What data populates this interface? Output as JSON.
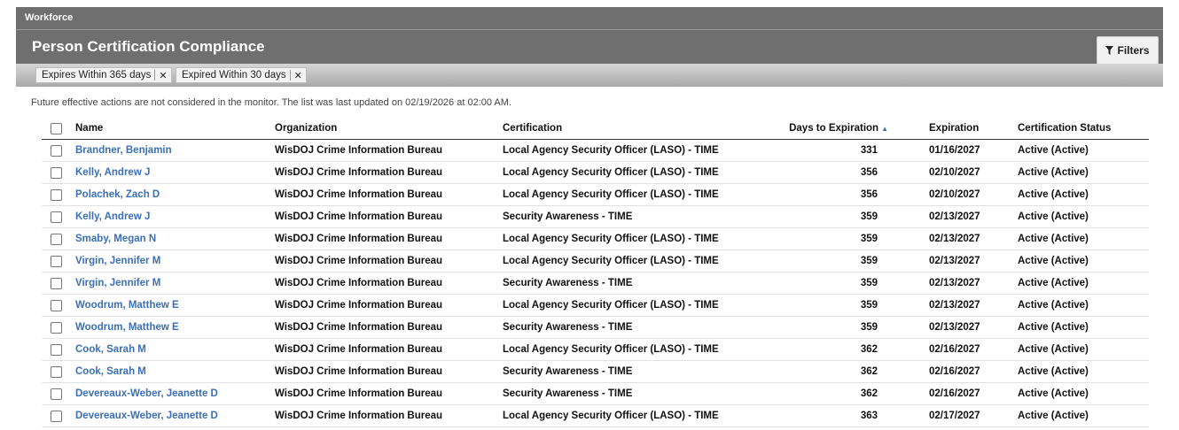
{
  "header": {
    "breadcrumb": "Workforce",
    "title": "Person Certification Compliance",
    "filters_label": "Filters"
  },
  "chips": [
    {
      "label": "Expires Within 365 days",
      "remove": "✕"
    },
    {
      "label": "Expired Within 30 days",
      "remove": "✕"
    }
  ],
  "notice": "Future effective actions are not considered in the monitor. The list was last updated on 02/19/2026 at 02:00 AM.",
  "table": {
    "columns": {
      "name": "Name",
      "org": "Organization",
      "cert": "Certification",
      "days": "Days to Expiration",
      "exp": "Expiration",
      "status": "Certification Status"
    },
    "rows": [
      {
        "name": "Brandner, Benjamin",
        "org": "WisDOJ Crime Information Bureau",
        "cert": "Local Agency Security Officer (LASO) - TIME",
        "days": "331",
        "exp": "01/16/2027",
        "status": "Active (Active)"
      },
      {
        "name": "Kelly, Andrew J",
        "org": "WisDOJ Crime Information Bureau",
        "cert": "Local Agency Security Officer (LASO) - TIME",
        "days": "356",
        "exp": "02/10/2027",
        "status": "Active (Active)"
      },
      {
        "name": "Polachek, Zach D",
        "org": "WisDOJ Crime Information Bureau",
        "cert": "Local Agency Security Officer (LASO) - TIME",
        "days": "356",
        "exp": "02/10/2027",
        "status": "Active (Active)"
      },
      {
        "name": "Kelly, Andrew J",
        "org": "WisDOJ Crime Information Bureau",
        "cert": "Security Awareness - TIME",
        "days": "359",
        "exp": "02/13/2027",
        "status": "Active (Active)"
      },
      {
        "name": "Smaby, Megan N",
        "org": "WisDOJ Crime Information Bureau",
        "cert": "Local Agency Security Officer (LASO) - TIME",
        "days": "359",
        "exp": "02/13/2027",
        "status": "Active (Active)"
      },
      {
        "name": "Virgin, Jennifer M",
        "org": "WisDOJ Crime Information Bureau",
        "cert": "Local Agency Security Officer (LASO) - TIME",
        "days": "359",
        "exp": "02/13/2027",
        "status": "Active (Active)"
      },
      {
        "name": "Virgin, Jennifer M",
        "org": "WisDOJ Crime Information Bureau",
        "cert": "Security Awareness - TIME",
        "days": "359",
        "exp": "02/13/2027",
        "status": "Active (Active)"
      },
      {
        "name": "Woodrum, Matthew E",
        "org": "WisDOJ Crime Information Bureau",
        "cert": "Local Agency Security Officer (LASO) - TIME",
        "days": "359",
        "exp": "02/13/2027",
        "status": "Active (Active)"
      },
      {
        "name": "Woodrum, Matthew E",
        "org": "WisDOJ Crime Information Bureau",
        "cert": "Security Awareness - TIME",
        "days": "359",
        "exp": "02/13/2027",
        "status": "Active (Active)"
      },
      {
        "name": "Cook, Sarah M",
        "org": "WisDOJ Crime Information Bureau",
        "cert": "Local Agency Security Officer (LASO) - TIME",
        "days": "362",
        "exp": "02/16/2027",
        "status": "Active (Active)"
      },
      {
        "name": "Cook, Sarah M",
        "org": "WisDOJ Crime Information Bureau",
        "cert": "Security Awareness - TIME",
        "days": "362",
        "exp": "02/16/2027",
        "status": "Active (Active)"
      },
      {
        "name": "Devereaux-Weber, Jeanette D",
        "org": "WisDOJ Crime Information Bureau",
        "cert": "Security Awareness - TIME",
        "days": "362",
        "exp": "02/16/2027",
        "status": "Active (Active)"
      },
      {
        "name": "Devereaux-Weber, Jeanette D",
        "org": "WisDOJ Crime Information Bureau",
        "cert": "Local Agency Security Officer (LASO) - TIME",
        "days": "363",
        "exp": "02/17/2027",
        "status": "Active (Active)"
      }
    ]
  }
}
